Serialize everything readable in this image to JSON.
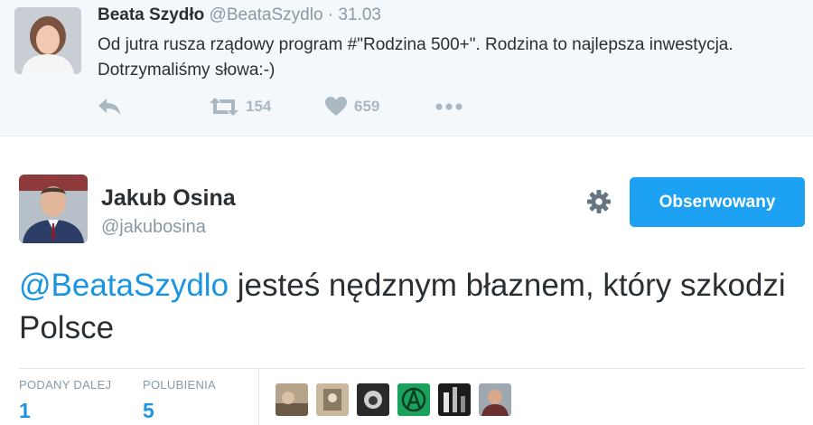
{
  "parent_tweet": {
    "author_name": "Beata Szydło",
    "handle": "@BeataSzydlo",
    "separator": "·",
    "date": "31.03",
    "text": "Od jutra rusza rządowy program #\"Rodzina 500+\". Rodzina to najlepsza inwestycja. Dotrzymaliśmy słowa:-)",
    "actions": {
      "reply_icon": "reply-icon",
      "retweet_icon": "retweet-icon",
      "retweet_count": "154",
      "like_icon": "heart-icon",
      "like_count": "659",
      "more_icon": "more-dots-icon"
    }
  },
  "main_tweet": {
    "author_name": "Jakub Osina",
    "handle": "@jakubosina",
    "settings_icon": "gear-icon",
    "follow_label": "Obserwowany",
    "mention": "@BeataSzydlo",
    "text": " jesteś nędznym błaznem, który szkodzi Polsce",
    "stats": {
      "retweets_label": "PODANY DALEJ",
      "retweets_value": "1",
      "likes_label": "POLUBIENIA",
      "likes_value": "5"
    },
    "likers_count": 6
  },
  "colors": {
    "accent": "#1da1f2",
    "link": "#1b95e0",
    "muted": "#8899a6",
    "action_icon": "#aab8c2",
    "parent_background": "#f5f8fa"
  }
}
